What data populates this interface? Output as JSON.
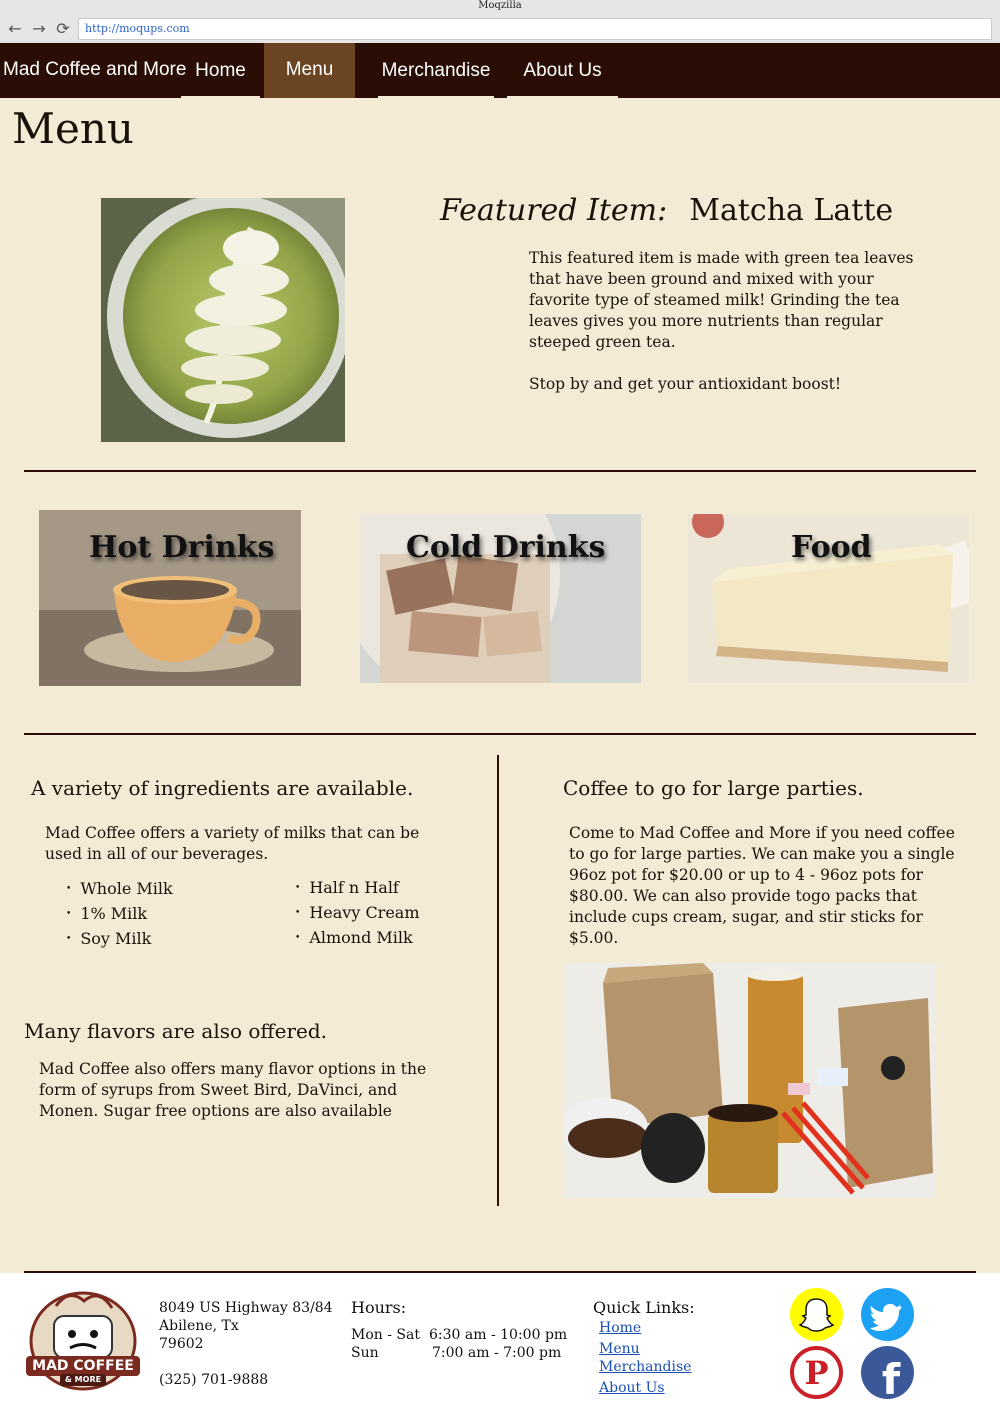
{
  "browser": {
    "title": "Moqzilla",
    "url": "http://moqups.com",
    "back_icon": "←",
    "forward_icon": "→",
    "reload_icon": "⟳"
  },
  "nav": {
    "brand": "Mad Coffee and More",
    "links": [
      "Home",
      "Menu",
      "Merchandise",
      "About Us"
    ],
    "active": "Menu"
  },
  "page": {
    "title": "Menu"
  },
  "featured": {
    "label": "Featured Item:",
    "name": "Matcha Latte",
    "description": "This featured item is made with green tea leaves that have been ground and mixed with your favorite type of steamed milk! Grinding the tea leaves gives you more nutrients than regular steeped green tea.",
    "tagline": "Stop by and get your antioxidant boost!"
  },
  "categories": [
    "Hot Drinks",
    "Cold Drinks",
    "Food"
  ],
  "ingredients": {
    "heading": "A variety of ingredients are available.",
    "text": "Mad Coffee offers a variety of milks  that can be used in all of our beverages.",
    "milks_left": [
      "Whole Milk",
      "1% Milk",
      "Soy Milk"
    ],
    "milks_right": [
      "Half n Half",
      "Heavy Cream",
      "Almond Milk"
    ]
  },
  "flavors": {
    "heading": "Many flavors are also offered.",
    "text": "Mad Coffee also offers many flavor options in the form of syrups from Sweet Bird, DaVinci, and Monen. Sugar free options are also available"
  },
  "parties": {
    "heading": "Coffee to go for large parties.",
    "text": "Come to Mad Coffee and More if you need coffee to go for large parties. We can make you a single  96oz pot for $20.00  or up to 4 - 96oz pots for $80.00. We can also provide togo packs that include cups cream, sugar, and stir sticks for $5.00."
  },
  "footer": {
    "address_line1": "8049 US Highway 83/84",
    "address_line2": "Abilene, Tx",
    "address_line3": "79602",
    "phone": "(325) 701-9888",
    "hours_title": "Hours:",
    "hours": [
      {
        "days": "Mon - Sat",
        "time": "6:30 am - 10:00 pm"
      },
      {
        "days": "Sun",
        "time": "7:00 am - 7:00 pm"
      }
    ],
    "quick_links_title": "Quick Links:",
    "quick_links": [
      "Home",
      "Menu",
      "Merchandise",
      "About Us"
    ],
    "logo_text_1": "MAD COFFEE",
    "logo_text_2": "& MORE"
  },
  "colors": {
    "nav_bg": "#2a0e05",
    "nav_active": "#6b4523",
    "page_bg": "#f3ebd6",
    "snapchat": "#fffc00",
    "twitter": "#1da1f2",
    "pinterest": "#cb2027",
    "facebook": "#3b5998"
  }
}
